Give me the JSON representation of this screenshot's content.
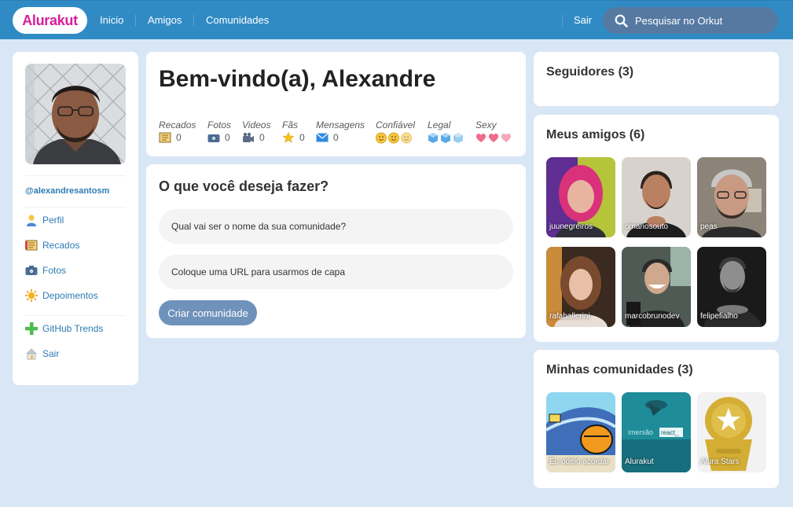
{
  "header": {
    "logo": "Alurakut",
    "nav": [
      "Inicio",
      "Amigos",
      "Comunidades"
    ],
    "logout": "Sair",
    "search_placeholder": "Pesquisar no Orkut"
  },
  "profile": {
    "handle": "@alexandresantosm",
    "menu": [
      {
        "label": "Perfil",
        "icon": "user-icon"
      },
      {
        "label": "Recados",
        "icon": "notes-icon"
      },
      {
        "label": "Fotos",
        "icon": "camera-icon"
      },
      {
        "label": "Depoimentos",
        "icon": "sun-icon"
      },
      {
        "label": "GitHub Trends",
        "icon": "plus-icon"
      },
      {
        "label": "Sair",
        "icon": "house-icon"
      }
    ]
  },
  "welcome": {
    "title": "Bem-vindo(a), Alexandre",
    "stats": [
      {
        "label": "Recados",
        "value": "0",
        "icon": "notes-icon"
      },
      {
        "label": "Fotos",
        "value": "0",
        "icon": "camera-icon"
      },
      {
        "label": "Videos",
        "value": "0",
        "icon": "video-icon"
      },
      {
        "label": "Fãs",
        "value": "0",
        "icon": "star-icon"
      },
      {
        "label": "Mensagens",
        "value": "0",
        "icon": "mail-icon"
      }
    ],
    "ratings": [
      {
        "label": "Confiável",
        "icon": "smiley-icon",
        "count": 3
      },
      {
        "label": "Legal",
        "icon": "ice-cube-icon",
        "count": 3
      },
      {
        "label": "Sexy",
        "icon": "heart-icon",
        "count": 3
      }
    ]
  },
  "community_form": {
    "title": "O que você deseja fazer?",
    "name_placeholder": "Qual vai ser o nome da sua comunidade?",
    "image_placeholder": "Coloque uma URL para usarmos de capa",
    "submit_label": "Criar comunidade"
  },
  "followers": {
    "title": "Seguidores (3)"
  },
  "friends": {
    "title": "Meus amigos (6)",
    "items": [
      "juunegreiros",
      "omariosouto",
      "peas",
      "rafaballerini",
      "marcobrunodev",
      "felipefialho"
    ]
  },
  "communities": {
    "title": "Minhas comunidades (3)",
    "items": [
      "Eu odeio acordar",
      "Alurakut",
      "Alura Stars"
    ]
  },
  "colors": {
    "header": "#308BC5",
    "background": "#D9E6F6",
    "logo_text": "#D81D99",
    "link": "#2E7BB4",
    "button": "#6F92BB"
  }
}
